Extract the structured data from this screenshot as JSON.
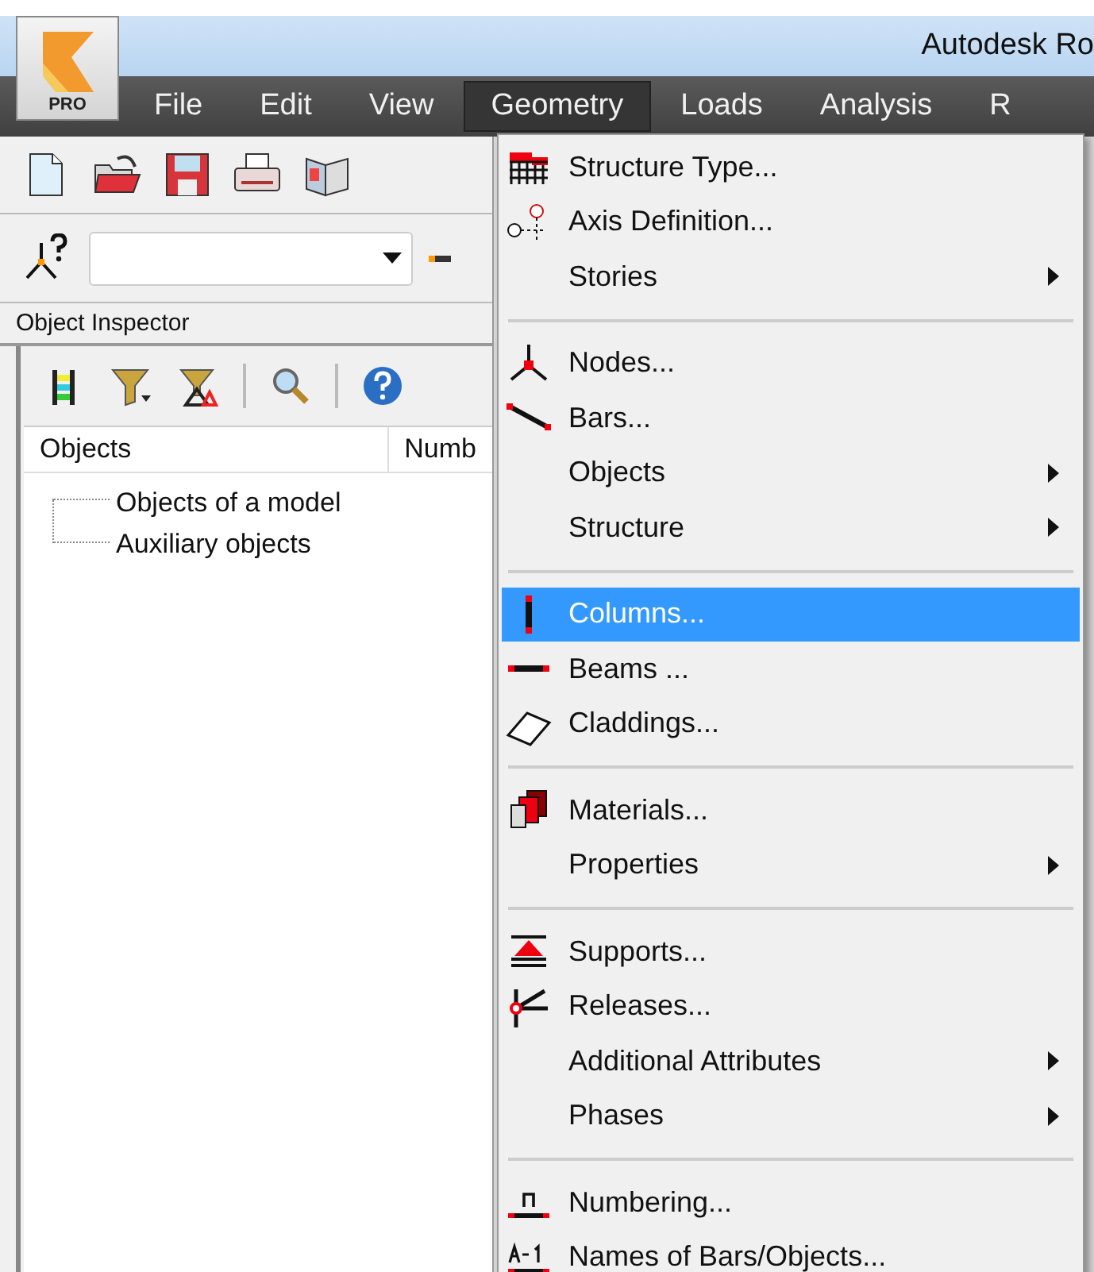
{
  "window": {
    "title": "Autodesk Ro",
    "logo_label": "PRO"
  },
  "menubar": [
    {
      "label": "File",
      "selected": false
    },
    {
      "label": "Edit",
      "selected": false
    },
    {
      "label": "View",
      "selected": false
    },
    {
      "label": "Geometry",
      "selected": true
    },
    {
      "label": "Loads",
      "selected": false
    },
    {
      "label": "Analysis",
      "selected": false
    },
    {
      "label": "R",
      "selected": false
    }
  ],
  "inspector": {
    "title": "Object Inspector",
    "columns": [
      "Objects",
      "Numb"
    ],
    "tree": [
      {
        "label": "Objects of a model"
      },
      {
        "label": "Auxiliary objects"
      }
    ]
  },
  "menu": [
    {
      "kind": "item",
      "label": "Structure Type...",
      "submenu": false,
      "selected": false
    },
    {
      "kind": "item",
      "label": "Axis Definition...",
      "submenu": false,
      "selected": false
    },
    {
      "kind": "item",
      "label": "Stories",
      "submenu": true,
      "selected": false
    },
    {
      "kind": "separator"
    },
    {
      "kind": "item",
      "label": "Nodes...",
      "submenu": false,
      "selected": false
    },
    {
      "kind": "item",
      "label": "Bars...",
      "submenu": false,
      "selected": false
    },
    {
      "kind": "item",
      "label": "Objects",
      "submenu": true,
      "selected": false
    },
    {
      "kind": "item",
      "label": "Structure",
      "submenu": true,
      "selected": false
    },
    {
      "kind": "separator"
    },
    {
      "kind": "item",
      "label": "Columns...",
      "submenu": false,
      "selected": true
    },
    {
      "kind": "item",
      "label": "Beams ...",
      "submenu": false,
      "selected": false
    },
    {
      "kind": "item",
      "label": "Claddings...",
      "submenu": false,
      "selected": false
    },
    {
      "kind": "separator"
    },
    {
      "kind": "item",
      "label": "Materials...",
      "submenu": false,
      "selected": false
    },
    {
      "kind": "item",
      "label": "Properties",
      "submenu": true,
      "selected": false
    },
    {
      "kind": "separator"
    },
    {
      "kind": "item",
      "label": "Supports...",
      "submenu": false,
      "selected": false
    },
    {
      "kind": "item",
      "label": "Releases...",
      "submenu": false,
      "selected": false
    },
    {
      "kind": "item",
      "label": "Additional Attributes",
      "submenu": true,
      "selected": false
    },
    {
      "kind": "item",
      "label": "Phases",
      "submenu": true,
      "selected": false
    },
    {
      "kind": "separator"
    },
    {
      "kind": "item",
      "label": "Numbering...",
      "submenu": false,
      "selected": false
    },
    {
      "kind": "item",
      "label": "Names of Bars/Objects...",
      "submenu": false,
      "selected": false
    }
  ]
}
